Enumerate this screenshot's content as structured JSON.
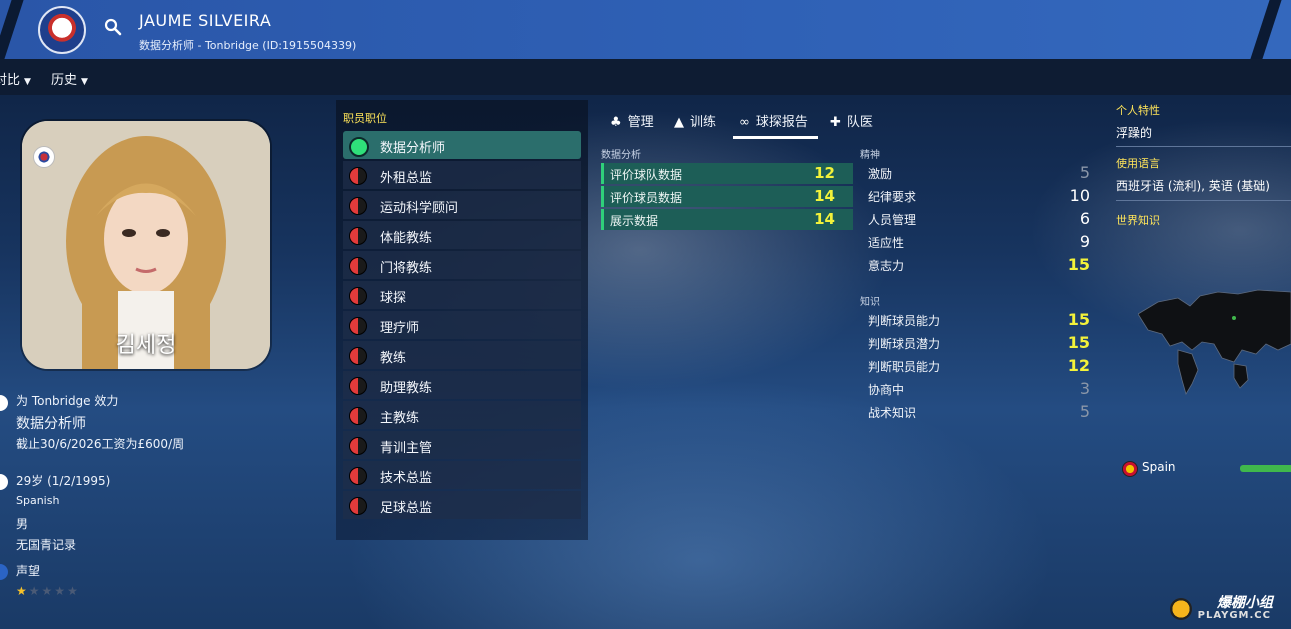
{
  "header": {
    "name": "JAUME SILVEIRA",
    "subtitle": "数据分析师 - Tonbridge (ID:1915504339)"
  },
  "menu": {
    "compare": "对比",
    "history": "历史"
  },
  "profile": {
    "photo_label": "김세정",
    "works_for": "为 Tonbridge 效力",
    "job": "数据分析师",
    "contract": "截止30/6/2026工资为£600/周",
    "age": "29岁 (1/2/1995)",
    "nationality": "Spanish",
    "gender": "男",
    "youth": "无国青记录",
    "reputation_label": "声望",
    "reputation_stars": 1,
    "reputation_max": 5
  },
  "roles": {
    "title": "职员职位",
    "items": [
      {
        "label": "数据分析师",
        "selected": true
      },
      {
        "label": "外租总监"
      },
      {
        "label": "运动科学顾问"
      },
      {
        "label": "体能教练"
      },
      {
        "label": "门将教练"
      },
      {
        "label": "球探"
      },
      {
        "label": "理疗师"
      },
      {
        "label": "教练"
      },
      {
        "label": "助理教练"
      },
      {
        "label": "主教练"
      },
      {
        "label": "青训主管"
      },
      {
        "label": "技术总监"
      },
      {
        "label": "足球总监"
      }
    ]
  },
  "tabs": [
    {
      "label": "管理",
      "icon": "manage-icon"
    },
    {
      "label": "训练",
      "icon": "training-cone-icon"
    },
    {
      "label": "球探报告",
      "icon": "binoculars-icon",
      "active": true
    },
    {
      "label": "队医",
      "icon": "medical-kit-icon"
    }
  ],
  "data_analysis": {
    "title": "数据分析",
    "rows": [
      {
        "label": "评价球队数据",
        "value": "12"
      },
      {
        "label": "评价球员数据",
        "value": "14"
      },
      {
        "label": "展示数据",
        "value": "14"
      }
    ]
  },
  "mental": {
    "title": "精神",
    "rows": [
      {
        "label": "激励",
        "value": "5",
        "tone": "grey"
      },
      {
        "label": "纪律要求",
        "value": "10",
        "tone": "white"
      },
      {
        "label": "人员管理",
        "value": "6",
        "tone": "white"
      },
      {
        "label": "适应性",
        "value": "9",
        "tone": "white"
      },
      {
        "label": "意志力",
        "value": "15",
        "tone": "yellow"
      }
    ]
  },
  "knowledge": {
    "title": "知识",
    "rows": [
      {
        "label": "判断球员能力",
        "value": "15",
        "tone": "yellow"
      },
      {
        "label": "判断球员潜力",
        "value": "15",
        "tone": "yellow"
      },
      {
        "label": "判断职员能力",
        "value": "12",
        "tone": "yellow"
      },
      {
        "label": "协商中",
        "value": "3",
        "tone": "grey"
      },
      {
        "label": "战术知识",
        "value": "5",
        "tone": "grey"
      }
    ]
  },
  "right": {
    "personality_title": "个人特性",
    "personality": "浮躁的",
    "languages_title": "使用语言",
    "languages": "西班牙语 (流利), 英语 (基础)",
    "world_title": "世界知识",
    "nation": "Spain",
    "nation_knowledge": 0.8
  },
  "watermark": {
    "main": "爆棚小组",
    "sub": "PLAYGM.CC"
  },
  "colors": {
    "accent": "#2f61b6",
    "selected_role": "#2b6e6c",
    "highlight_value": "#f3f23a",
    "section_title": "#ffe55a"
  }
}
